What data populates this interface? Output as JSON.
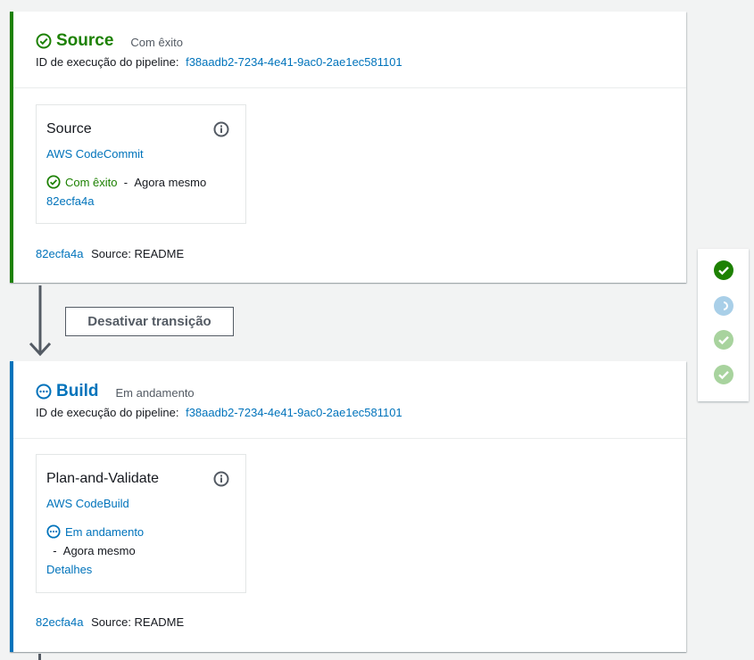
{
  "stages": [
    {
      "name": "Source",
      "status": "Com êxito",
      "exec_label": "ID de execução do pipeline:",
      "exec_id": "f38aadb2-7234-4e41-9ac0-2ae1ec581101",
      "action": {
        "name": "Source",
        "provider": "AWS CodeCommit",
        "status": "Com êxito",
        "time": "Agora mesmo",
        "link": "82ecfa4a"
      },
      "footer": {
        "commit": "82ecfa4a",
        "text": "Source: README"
      }
    },
    {
      "name": "Build",
      "status": "Em andamento",
      "exec_label": "ID de execução do pipeline:",
      "exec_id": "f38aadb2-7234-4e41-9ac0-2ae1ec581101",
      "action": {
        "name": "Plan-and-Validate",
        "provider": "AWS CodeBuild",
        "status": "Em andamento",
        "time": "Agora mesmo",
        "link": "Detalhes"
      },
      "footer": {
        "commit": "82ecfa4a",
        "text": "Source: README"
      }
    }
  ],
  "transition": {
    "label": "Desativar transição"
  },
  "colors": {
    "success": "#1d8102",
    "progress": "#0073bb",
    "success_faded": "#a8d39e",
    "progress_faded": "#a9cfe8"
  },
  "side_panel": {
    "icons": [
      "check-circle-icon",
      "in-progress-icon",
      "check-circle-faded-icon",
      "check-circle-faded-icon"
    ]
  }
}
